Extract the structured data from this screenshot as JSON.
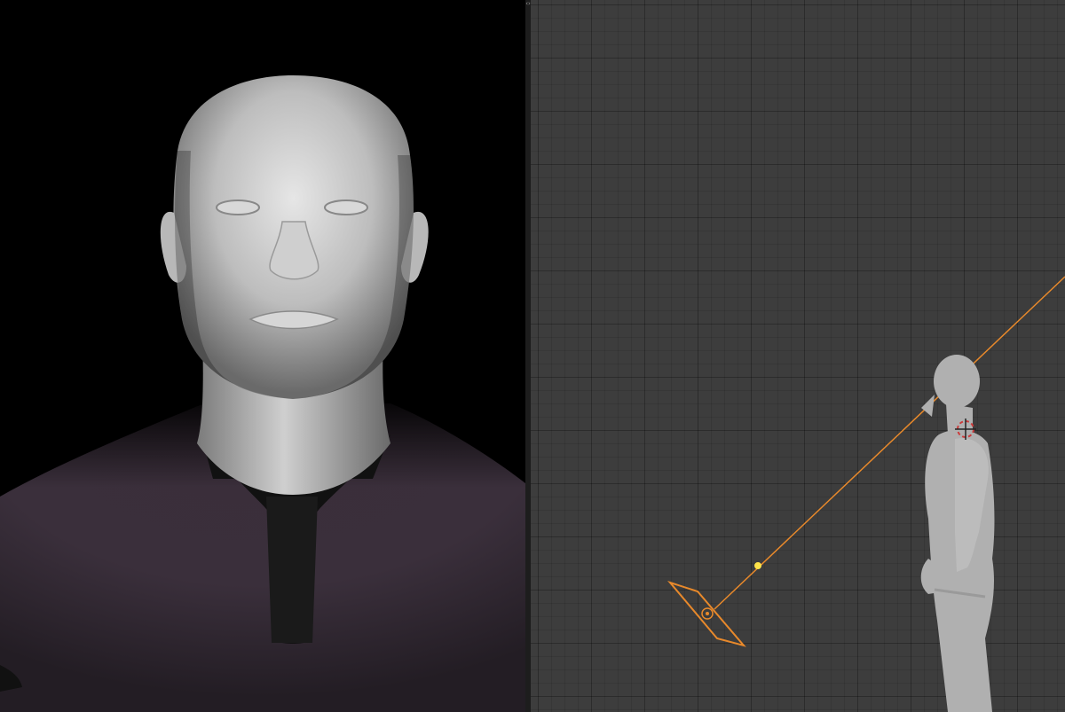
{
  "render_view": {
    "panel_name": "",
    "background": "#000000",
    "skin_color": "#c9c9c9",
    "shirt_color": "#2f2530",
    "undershirt_color": "#151515"
  },
  "splitter": {
    "handle_glyph": "‹›"
  },
  "viewport": {
    "background": "#3d3d3d",
    "grid": true,
    "selection_color": "#e8892b",
    "light_point_color": "#ffe44a",
    "figure_color": "#b5b5b5"
  },
  "icons": {
    "light_empty": "light-empty-icon",
    "light_cursor": "3d-cursor-icon",
    "splitter": "area-splitter-icon"
  }
}
